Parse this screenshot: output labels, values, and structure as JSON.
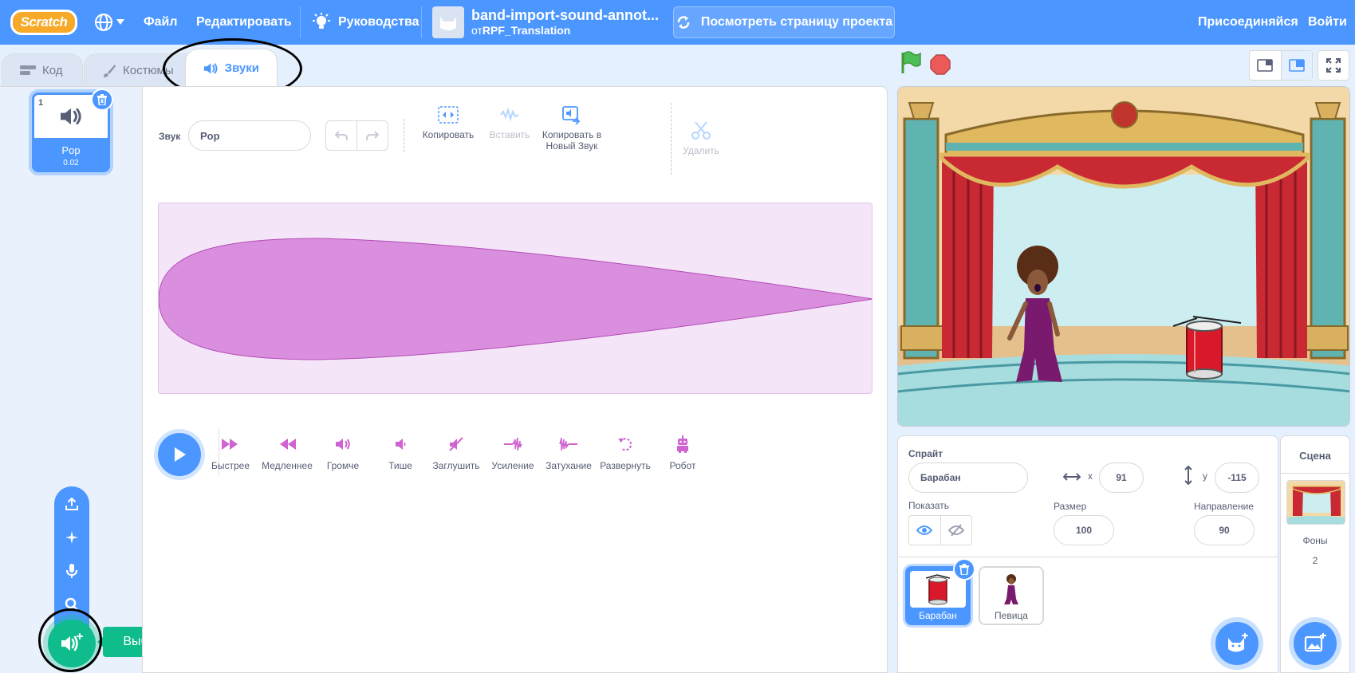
{
  "menubar": {
    "logo": "Scratch",
    "file": "Файл",
    "edit": "Редактировать",
    "tutorials": "Руководства",
    "project_title": "band-import-sound-annot...",
    "author_prefix": "от",
    "author": "RPF_Translation",
    "see_project": "Посмотреть страницу проекта",
    "join": "Присоединяйся",
    "sign_in": "Войти"
  },
  "tabs": {
    "code": "Код",
    "costumes": "Костюмы",
    "sounds": "Звуки"
  },
  "sound_list": {
    "items": [
      {
        "index": "1",
        "name": "Pop",
        "duration": "0.02"
      }
    ],
    "choose_sound_tooltip": "Выбрать звук"
  },
  "editor": {
    "sound_label": "Звук",
    "sound_name": "Pop",
    "tools": {
      "copy": "Копировать",
      "paste": "Вставить",
      "copy_new": "Копировать в Новый Звук",
      "delete": "Удалить"
    },
    "effects": [
      "Быстрее",
      "Медленнее",
      "Громче",
      "Тише",
      "Заглушить",
      "Усиление",
      "Затухание",
      "Развернуть",
      "Робот"
    ],
    "waveform_color": "#cf63cf"
  },
  "sprite_info": {
    "sprite_label": "Спрайт",
    "sprite_name": "Барабан",
    "x_label": "x",
    "x_value": "91",
    "y_label": "y",
    "y_value": "-115",
    "show_label": "Показать",
    "size_label": "Размер",
    "size_value": "100",
    "direction_label": "Направление",
    "direction_value": "90",
    "sprites": [
      "Барабан",
      "Певица"
    ]
  },
  "stage_pane": {
    "title": "Сцена",
    "backdrops_label": "Фоны",
    "backdrops_count": "2"
  },
  "colors": {
    "menubar": "#4c97ff",
    "accent": "#4c97ff",
    "green": "#0fbd8c",
    "sound_purple": "#cf63cf"
  }
}
